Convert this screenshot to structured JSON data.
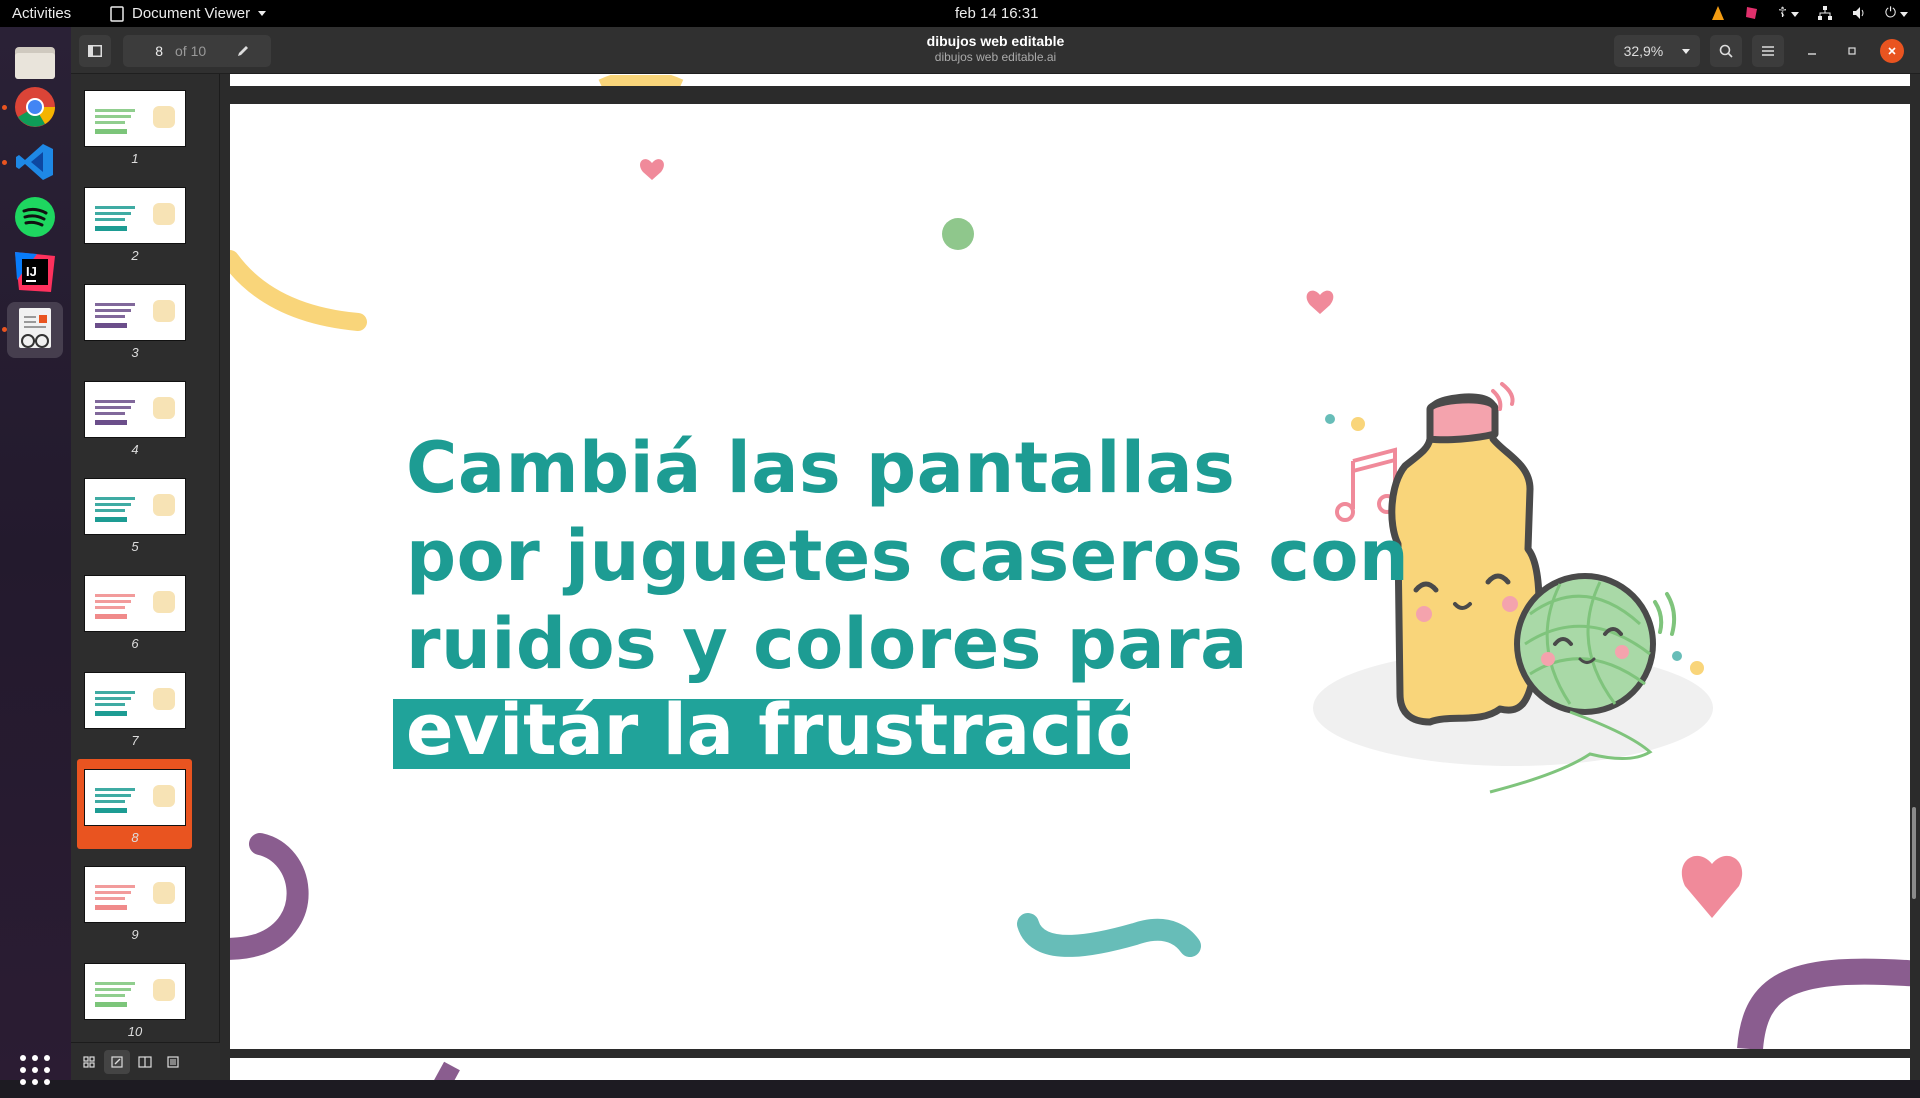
{
  "topbar": {
    "activities": "Activities",
    "app_name": "Document Viewer",
    "clock": "feb 14  16:31"
  },
  "window": {
    "title": "dibujos web editable",
    "subtitle": "dibujos web editable.ai",
    "page_current": "8",
    "page_total": "of 10",
    "zoom": "32,9%"
  },
  "sidebar": {
    "thumbnails": [
      {
        "label": "1",
        "accent": "#7cc57a"
      },
      {
        "label": "2",
        "accent": "#1d9c93"
      },
      {
        "label": "3",
        "accent": "#6b4e8a"
      },
      {
        "label": "4",
        "accent": "#6b4e8a"
      },
      {
        "label": "5",
        "accent": "#1d9c93"
      },
      {
        "label": "6",
        "accent": "#f08a8a"
      },
      {
        "label": "7",
        "accent": "#1d9c93"
      },
      {
        "label": "8",
        "accent": "#1d9c93"
      },
      {
        "label": "9",
        "accent": "#f08a8a"
      },
      {
        "label": "10",
        "accent": "#7cc57a"
      }
    ],
    "selected": "8"
  },
  "slide": {
    "line1": "Cambiá las pantallas",
    "line2": "por juguetes caseros con",
    "line3": "ruidos y colores para",
    "highlight": "evitár la frustración."
  },
  "colors": {
    "accent": "#e95420",
    "teal": "#1d9c93",
    "yellow": "#f9d57a",
    "pink": "#f08a9a",
    "purple": "#8a5d8f"
  }
}
